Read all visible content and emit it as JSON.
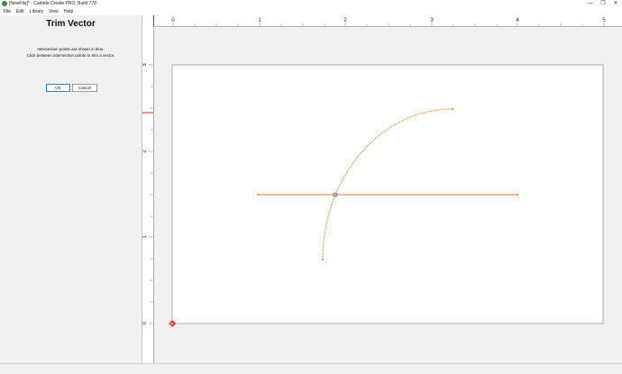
{
  "window": {
    "title": "[NewFile]* - Carbide Create PRO, Build 778",
    "minimize": "—",
    "maximize": "❐",
    "close": "✕"
  },
  "menu": {
    "file": "File",
    "edit": "Edit",
    "library": "Library",
    "view": "View",
    "help": "Help"
  },
  "panel": {
    "title": "Trim Vector",
    "line1": "Intersection points are shown in blue.",
    "line2": "Click between intersection points to trim a vector.",
    "ok": "OK",
    "cancel": "Cancel"
  },
  "ruler": {
    "top_labels": [
      "0",
      "1",
      "2",
      "3",
      "4",
      "5"
    ],
    "left_labels": [
      "3",
      "2",
      "1",
      "0"
    ]
  },
  "colors": {
    "vector": "#f07828",
    "intersection": "#3a50c8",
    "ruler_marker": "#e02020"
  }
}
